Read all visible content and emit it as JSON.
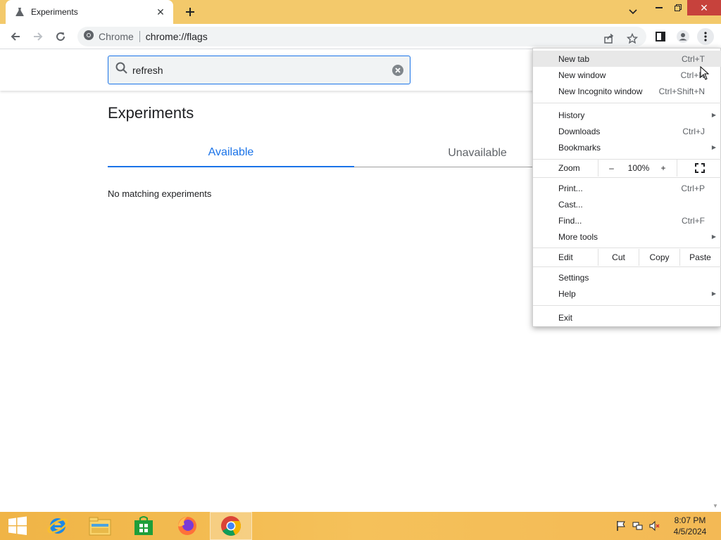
{
  "browser": {
    "tab_title": "Experiments",
    "omnibox_site": "Chrome",
    "omnibox_url": "chrome://flags"
  },
  "flags_page": {
    "search_value": "refresh",
    "title": "Experiments",
    "tab_available": "Available",
    "tab_unavailable": "Unavailable",
    "empty_message": "No matching experiments"
  },
  "menu": {
    "new_tab": {
      "label": "New tab",
      "shortcut": "Ctrl+T"
    },
    "new_window": {
      "label": "New window",
      "shortcut": "Ctrl+N"
    },
    "new_incognito": {
      "label": "New Incognito window",
      "shortcut": "Ctrl+Shift+N"
    },
    "history": {
      "label": "History"
    },
    "downloads": {
      "label": "Downloads",
      "shortcut": "Ctrl+J"
    },
    "bookmarks": {
      "label": "Bookmarks"
    },
    "zoom": {
      "label": "Zoom",
      "minus": "–",
      "level": "100%",
      "plus": "+"
    },
    "print": {
      "label": "Print...",
      "shortcut": "Ctrl+P"
    },
    "cast": {
      "label": "Cast..."
    },
    "find": {
      "label": "Find...",
      "shortcut": "Ctrl+F"
    },
    "more_tools": {
      "label": "More tools"
    },
    "edit": {
      "label": "Edit",
      "cut": "Cut",
      "copy": "Copy",
      "paste": "Paste"
    },
    "settings": {
      "label": "Settings"
    },
    "help": {
      "label": "Help"
    },
    "exit": {
      "label": "Exit"
    }
  },
  "taskbar": {
    "time": "8:07 PM",
    "date": "4/5/2024",
    "apps": [
      "start-icon",
      "internet-explorer-icon",
      "file-explorer-icon",
      "store-icon",
      "firefox-icon",
      "chrome-icon"
    ]
  },
  "colors": {
    "accent": "#1a73e8",
    "titlebar": "#f3c96b",
    "close_button": "#c7423c",
    "taskbar": "#f0b446"
  }
}
